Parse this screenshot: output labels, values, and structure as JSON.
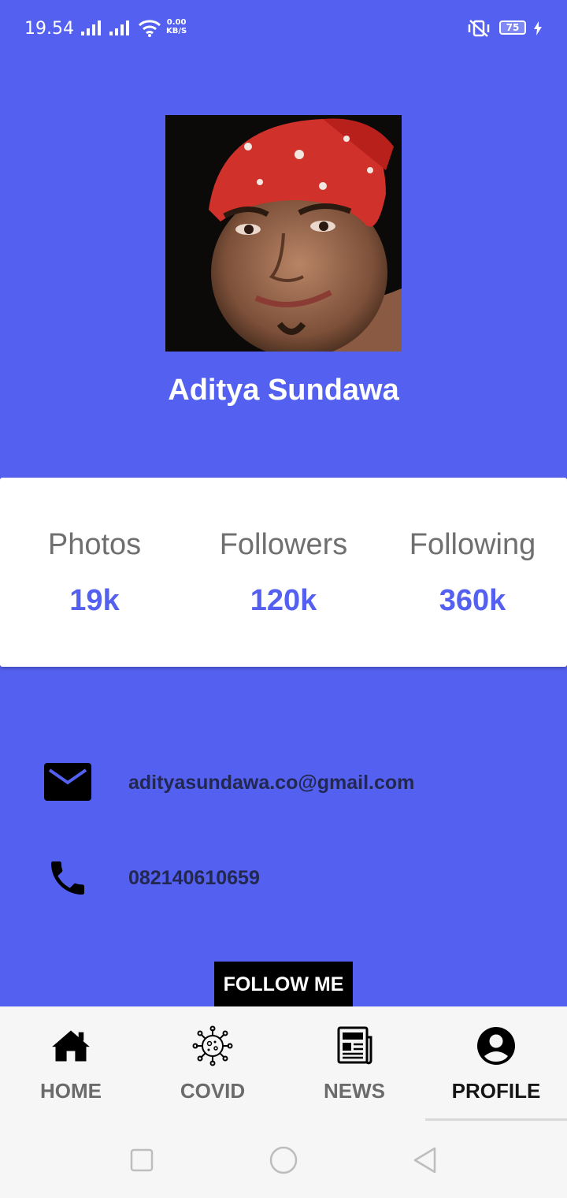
{
  "status_bar": {
    "time": "19.54",
    "net_speed_value": "0.00",
    "net_speed_unit": "KB/S",
    "battery": "75"
  },
  "profile": {
    "name": "Aditya Sundawa"
  },
  "stats": [
    {
      "label": "Photos",
      "value": "19k"
    },
    {
      "label": "Followers",
      "value": "120k"
    },
    {
      "label": "Following",
      "value": "360k"
    }
  ],
  "contact": {
    "email": "adityasundawa.co@gmail.com",
    "phone": "082140610659"
  },
  "follow_button_label": "FOLLOW ME",
  "bottom_nav": [
    {
      "label": "HOME",
      "icon": "home-icon"
    },
    {
      "label": "COVID",
      "icon": "virus-icon"
    },
    {
      "label": "NEWS",
      "icon": "newspaper-icon"
    },
    {
      "label": "PROFILE",
      "icon": "account-circle-icon",
      "active": true
    }
  ],
  "colors": {
    "primary": "#5460ef",
    "card": "#ffffff",
    "contact_text": "#222850",
    "button": "#000000"
  }
}
